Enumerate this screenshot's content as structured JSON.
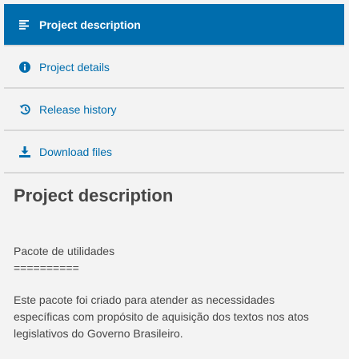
{
  "nav": {
    "items": [
      {
        "label": "Project description",
        "icon": "text-align-left-icon",
        "active": true
      },
      {
        "label": "Project details",
        "icon": "info-circle-icon",
        "active": false
      },
      {
        "label": "Release history",
        "icon": "history-icon",
        "active": false
      },
      {
        "label": "Download files",
        "icon": "download-icon",
        "active": false
      }
    ]
  },
  "content": {
    "title": "Project description",
    "line1": "Pacote de utilidades",
    "line2": "==========",
    "para_line1": "Este pacote foi criado para atender as necessidades",
    "para_line2": "específicas com propósito de aquisição dos textos nos atos",
    "para_line3": "legislativos do Governo Brasileiro."
  },
  "colors": {
    "accent": "#006dad",
    "background": "#f3f3f3",
    "text": "#464646",
    "divider": "#d8d8d8"
  }
}
